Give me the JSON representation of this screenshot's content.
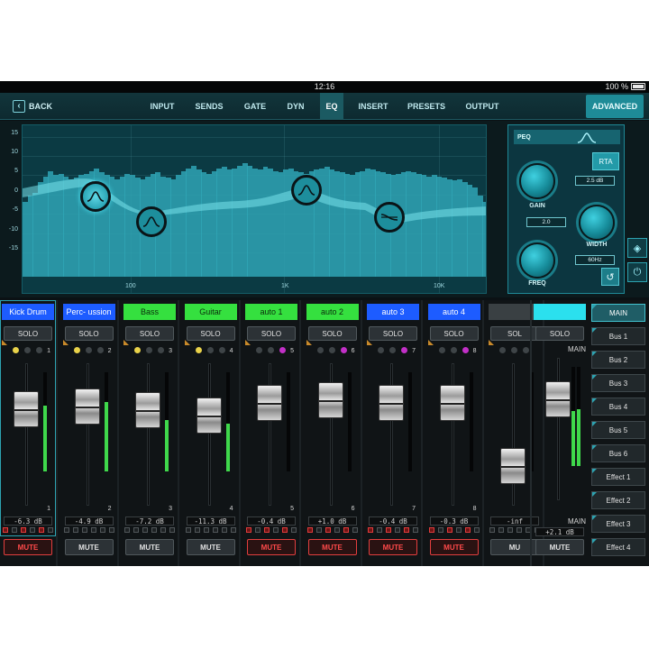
{
  "status": {
    "time": "12:16",
    "battery": "100 %"
  },
  "nav": {
    "back_label": "BACK",
    "tabs": [
      {
        "label": "INPUT"
      },
      {
        "label": "SENDS"
      },
      {
        "label": "GATE"
      },
      {
        "label": "DYN"
      },
      {
        "label": "EQ"
      },
      {
        "label": "INSERT"
      },
      {
        "label": "PRESETS"
      },
      {
        "label": "OUTPUT"
      }
    ],
    "active_tab": "EQ",
    "advanced_label": "ADVANCED"
  },
  "eq": {
    "y_labels": [
      "15",
      "10",
      "5",
      "0",
      "-5",
      "-10",
      "-15"
    ],
    "x_labels": [
      "100",
      "1K",
      "10K"
    ],
    "bands": [
      {
        "name": "band-1",
        "active": true
      },
      {
        "name": "band-2",
        "active": false
      },
      {
        "name": "band-3",
        "active": false
      },
      {
        "name": "band-4",
        "active": false
      }
    ],
    "rta_levels": [
      0.55,
      0.6,
      0.62,
      0.7,
      0.74,
      0.78,
      0.75,
      0.76,
      0.74,
      0.72,
      0.73,
      0.75,
      0.76,
      0.78,
      0.8,
      0.77,
      0.75,
      0.74,
      0.72,
      0.74,
      0.76,
      0.75,
      0.73,
      0.72,
      0.74,
      0.76,
      0.77,
      0.74,
      0.73,
      0.72,
      0.75,
      0.78,
      0.8,
      0.82,
      0.79,
      0.77,
      0.76,
      0.78,
      0.8,
      0.81,
      0.79,
      0.8,
      0.82,
      0.84,
      0.82,
      0.8,
      0.79,
      0.81,
      0.8,
      0.78,
      0.77,
      0.79,
      0.8,
      0.78,
      0.77,
      0.76,
      0.78,
      0.79,
      0.8,
      0.81,
      0.79,
      0.78,
      0.77,
      0.76,
      0.75,
      0.77,
      0.78,
      0.8,
      0.79,
      0.78,
      0.77,
      0.76,
      0.75,
      0.76,
      0.77,
      0.78,
      0.77,
      0.76,
      0.75,
      0.74,
      0.75,
      0.74,
      0.73,
      0.72,
      0.71,
      0.72,
      0.7,
      0.68,
      0.66,
      0.6,
      0.55
    ]
  },
  "peq": {
    "title": "PEQ",
    "rta_label": "RTA",
    "gain_label": "GAIN",
    "gain_value": "2.5 dB",
    "width_label": "WIDTH",
    "width_value": "2.0",
    "freq_label": "FREQ",
    "freq_value": "60Hz"
  },
  "channels": [
    {
      "name": "Kick Drum",
      "color": "#1d5cff",
      "text_color": "#ffffff",
      "num": "1",
      "gain": "-6.3 dB",
      "muted": true,
      "ind": [
        "yellow",
        "off",
        "off"
      ],
      "fader": 0.74,
      "meter": 0.66
    },
    {
      "name": "Perc- ussion",
      "color": "#1d5cff",
      "text_color": "#ffffff",
      "num": "2",
      "gain": "-4.9 dB",
      "muted": false,
      "ind": [
        "yellow",
        "off",
        "off"
      ],
      "fader": 0.76,
      "meter": 0.7
    },
    {
      "name": "Bass",
      "color": "#35e03f",
      "text_color": "#0a2a0c",
      "num": "3",
      "gain": "-7.2 dB",
      "muted": false,
      "ind": [
        "yellow",
        "off",
        "off"
      ],
      "fader": 0.73,
      "meter": 0.52
    },
    {
      "name": "Guitar",
      "color": "#35e03f",
      "text_color": "#0a2a0c",
      "num": "4",
      "gain": "-11.3 dB",
      "muted": false,
      "ind": [
        "yellow",
        "off",
        "off"
      ],
      "fader": 0.68,
      "meter": 0.48
    },
    {
      "name": "auto 1",
      "color": "#35e03f",
      "text_color": "#0a2a0c",
      "num": "5",
      "gain": "-0.4 dB",
      "muted": true,
      "ind": [
        "off",
        "off",
        "magenta"
      ],
      "fader": 0.8,
      "meter": 0
    },
    {
      "name": "auto 2",
      "color": "#35e03f",
      "text_color": "#0a2a0c",
      "num": "6",
      "gain": "+1.0 dB",
      "muted": true,
      "ind": [
        "off",
        "off",
        "magenta"
      ],
      "fader": 0.82,
      "meter": 0
    },
    {
      "name": "auto 3",
      "color": "#1d5cff",
      "text_color": "#ffffff",
      "num": "7",
      "gain": "-0.4 dB",
      "muted": true,
      "ind": [
        "off",
        "off",
        "magenta"
      ],
      "fader": 0.8,
      "meter": 0
    },
    {
      "name": "auto 4",
      "color": "#1d5cff",
      "text_color": "#ffffff",
      "num": "8",
      "gain": "-0.3 dB",
      "muted": true,
      "ind": [
        "off",
        "off",
        "magenta"
      ],
      "fader": 0.8,
      "meter": 0
    },
    {
      "name": "",
      "color": "#3a4043",
      "text_color": "#ffffff",
      "num": "",
      "gain": "-inf",
      "muted": false,
      "ind": [
        "off",
        "off",
        "off"
      ],
      "fader": 0.2,
      "meter": 0,
      "solo_label": "SOL",
      "mute_label": "MU"
    }
  ],
  "main": {
    "name_color": "#2be0ee",
    "solo_label": "SOLO",
    "top_label": "MAIN",
    "bottom_label": "MAIN",
    "gain": "+2.1 dB",
    "mute_label": "MUTE",
    "fader": 0.78,
    "meter_l": 0.55,
    "meter_r": 0.57
  },
  "labels": {
    "solo": "SOLO",
    "mute": "MUTE"
  },
  "buses": [
    {
      "label": "MAIN",
      "active": true
    },
    {
      "label": "Bus 1",
      "active": false
    },
    {
      "label": "Bus 2",
      "active": false
    },
    {
      "label": "Bus 3",
      "active": false
    },
    {
      "label": "Bus 4",
      "active": false
    },
    {
      "label": "Bus 5",
      "active": false
    },
    {
      "label": "Bus 6",
      "active": false
    },
    {
      "label": "Effect 1",
      "active": false
    },
    {
      "label": "Effect 2",
      "active": false
    },
    {
      "label": "Effect 3",
      "active": false
    },
    {
      "label": "Effect 4",
      "active": false
    }
  ]
}
